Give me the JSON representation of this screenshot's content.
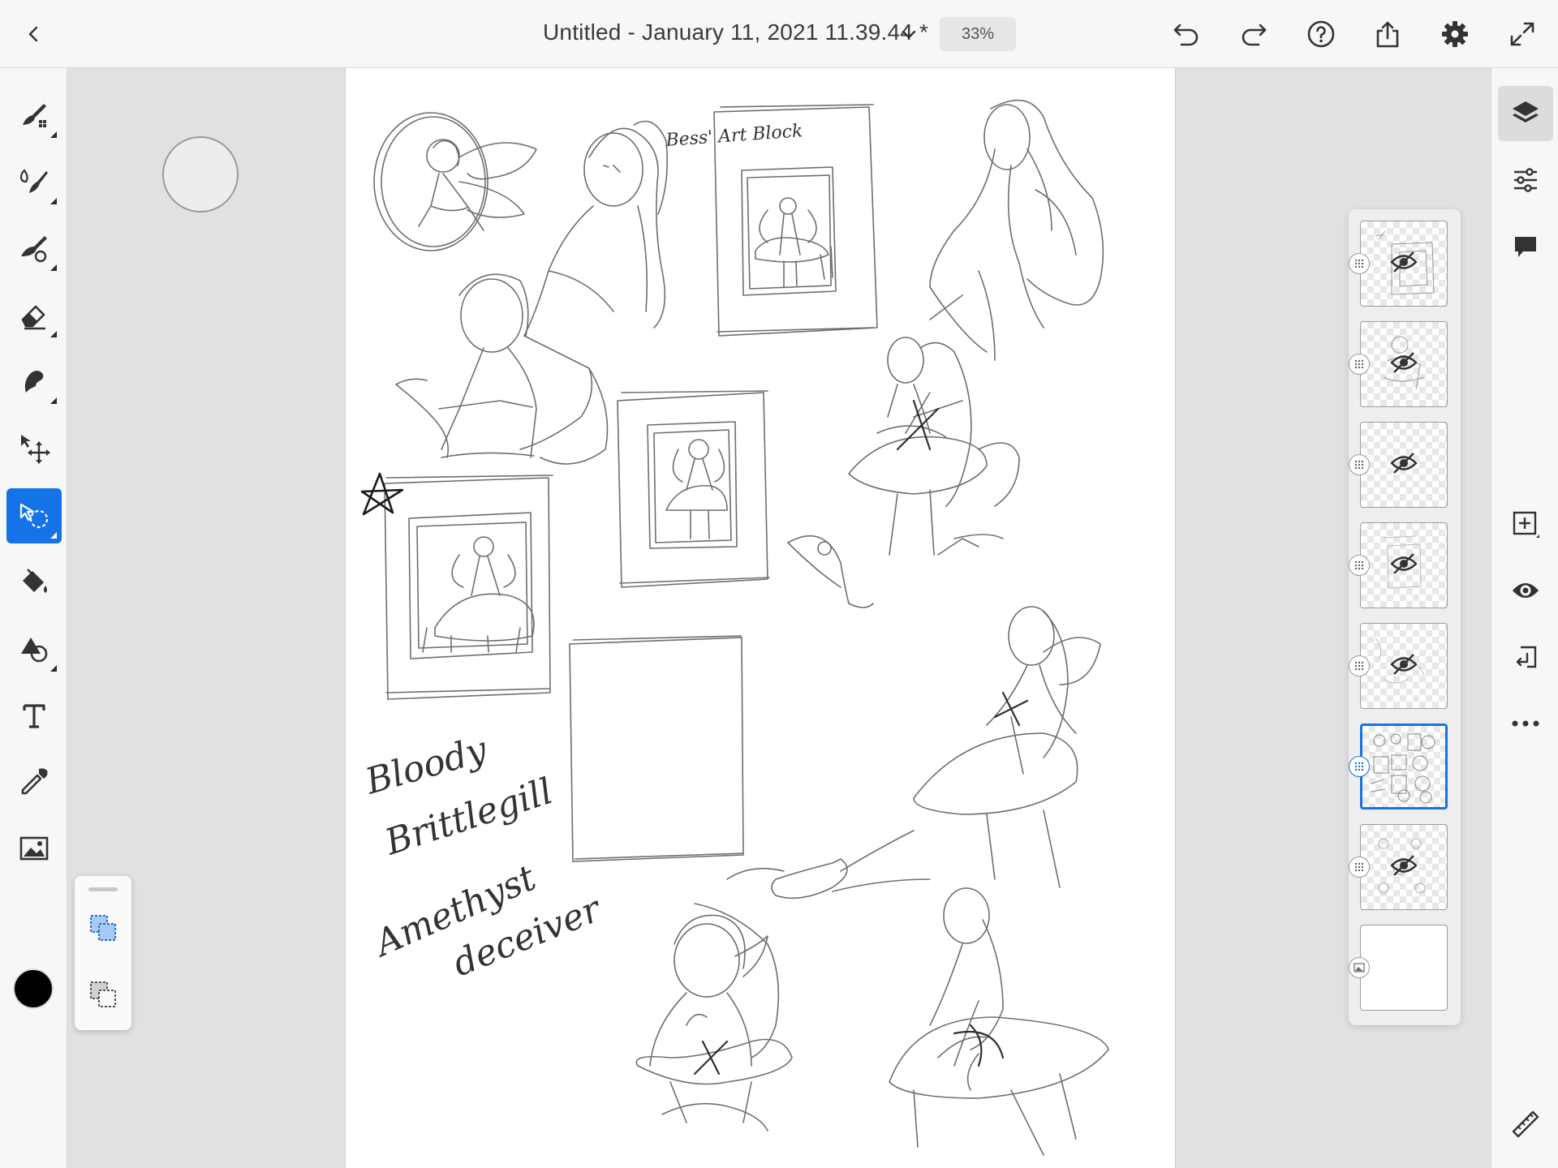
{
  "document": {
    "title": "Untitled - January 11, 2021 11.39.44 *",
    "zoom": "33%"
  },
  "topbar": {
    "back_icon": "chevron-left-icon",
    "title_dropdown_icon": "chevron-down-icon",
    "actions": [
      "undo-icon",
      "redo-icon",
      "help-icon",
      "share-icon",
      "settings-icon",
      "fullscreen-icon"
    ]
  },
  "left_toolbar": {
    "tools": [
      "pixel-brush-icon",
      "live-brush-icon",
      "vector-brush-icon",
      "eraser-icon",
      "smudge-icon",
      "transform-icon",
      "selection-icon",
      "fill-icon",
      "shapes-icon",
      "text-icon",
      "eyedropper-icon",
      "image-icon"
    ],
    "active_tool": "selection-icon",
    "current_color": "#000000",
    "selection_modes": [
      "add-selection-icon",
      "subtract-selection-icon"
    ]
  },
  "canvas": {
    "handwriting": {
      "sign_text": "Bess' Art Block",
      "note_line_1": "Bloody",
      "note_line_2": "Brittlegill",
      "note_line_3": "Amethyst",
      "note_line_4": "deceiver"
    }
  },
  "right_toolbar": {
    "tools": [
      "layers-icon",
      "properties-icon",
      "comments-icon"
    ],
    "active": "layers-icon",
    "layer_actions": [
      "add-layer-icon",
      "visibility-icon",
      "merge-down-icon",
      "more-icon"
    ],
    "bottom": "ruler-icon"
  },
  "layers": {
    "items": [
      {
        "type": "pixel",
        "visible": false,
        "selected": false
      },
      {
        "type": "pixel",
        "visible": false,
        "selected": false
      },
      {
        "type": "pixel",
        "visible": false,
        "selected": false
      },
      {
        "type": "pixel",
        "visible": false,
        "selected": false
      },
      {
        "type": "pixel",
        "visible": false,
        "selected": false
      },
      {
        "type": "pixel",
        "visible": true,
        "selected": true
      },
      {
        "type": "pixel",
        "visible": false,
        "selected": false
      },
      {
        "type": "background",
        "visible": true,
        "selected": false
      }
    ]
  },
  "colors": {
    "accent": "#1473e6",
    "toolbar_bg": "#f7f7f7",
    "workspace_bg": "#e1e1e1"
  }
}
